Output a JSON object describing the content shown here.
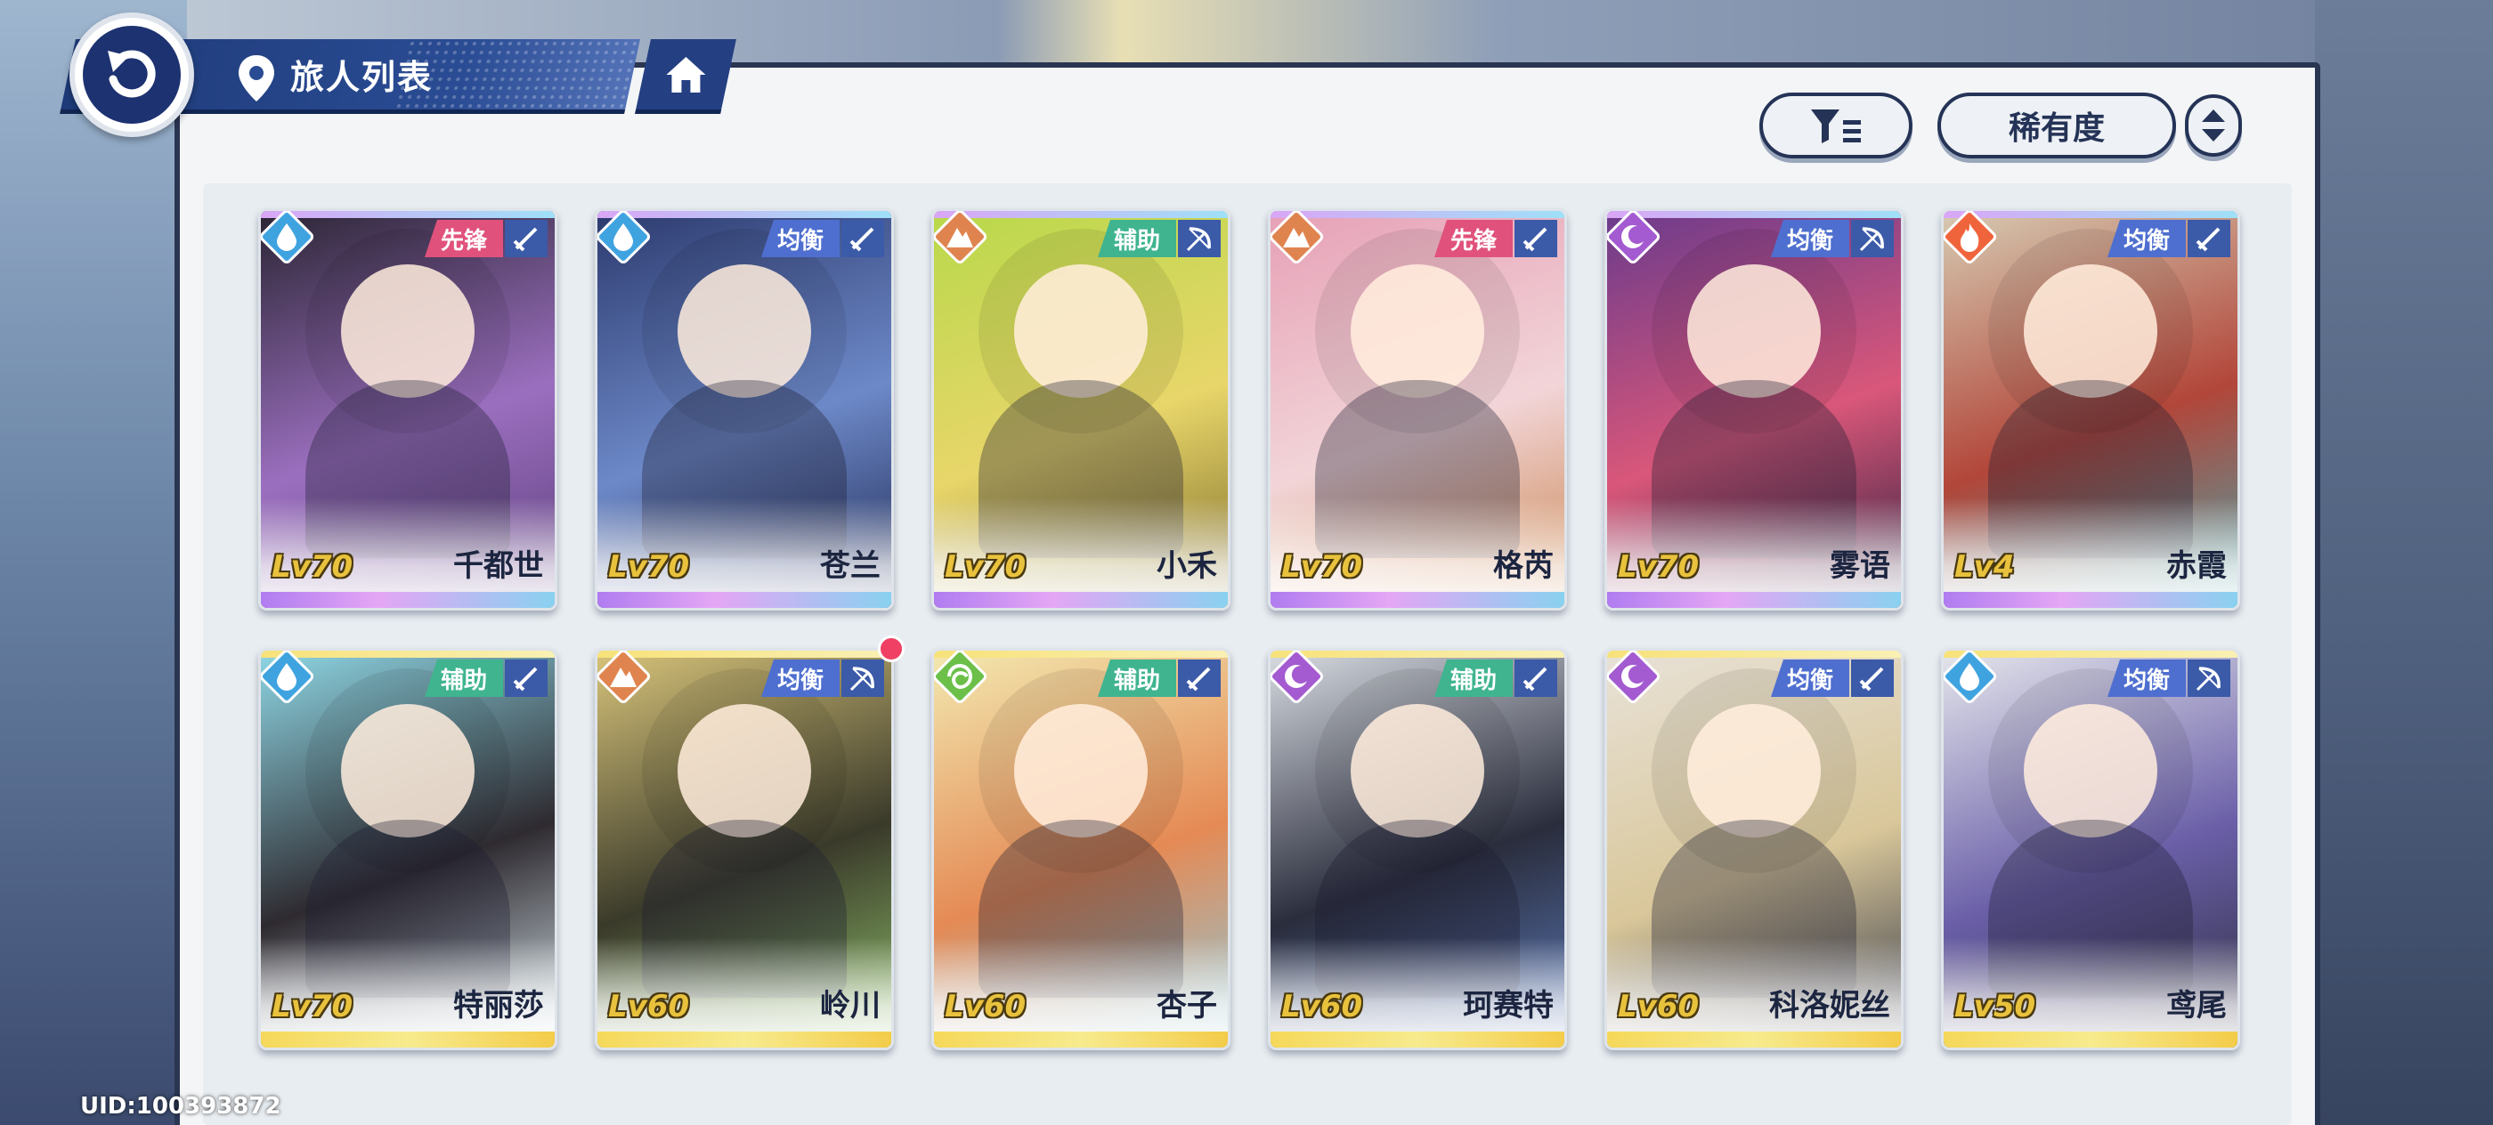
{
  "header": {
    "title": "旅人列表"
  },
  "toolbar": {
    "sort_label": "稀有度"
  },
  "footer": {
    "uid": "UID:100393872"
  },
  "colors": {
    "role": {
      "先锋": "#e0527c",
      "均衡": "#4e6fcf",
      "辅助": "#3fb48f"
    },
    "element": {
      "water": "#3fa3e0",
      "earth": "#e0844f",
      "moon": "#a45ad0",
      "fire": "#f0643c",
      "wind": "#6cc04a"
    }
  },
  "characters": [
    {
      "name": "千都世",
      "level": "Lv70",
      "role": "先锋",
      "element": "water",
      "weapon": "sword-icon",
      "frame": "purple",
      "art": [
        "#2a2533",
        "#9b6fbf",
        "#5b3d7a"
      ]
    },
    {
      "name": "苍兰",
      "level": "Lv70",
      "role": "均衡",
      "element": "water",
      "weapon": "sword-icon",
      "frame": "purple",
      "art": [
        "#2c3a6e",
        "#6d89c8",
        "#1d2650"
      ]
    },
    {
      "name": "小禾",
      "level": "Lv70",
      "role": "辅助",
      "element": "earth",
      "weapon": "bow-icon",
      "frame": "purple",
      "art": [
        "#b8d84a",
        "#e8d66a",
        "#7c6a2a"
      ]
    },
    {
      "name": "格芮",
      "level": "Lv70",
      "role": "先锋",
      "element": "earth",
      "weapon": "sword-icon",
      "frame": "purple",
      "art": [
        "#e6a0b6",
        "#f2d5d8",
        "#c9844d"
      ]
    },
    {
      "name": "雾语",
      "level": "Lv70",
      "role": "均衡",
      "element": "moon",
      "weapon": "bow-icon",
      "frame": "purple",
      "art": [
        "#6a3a8c",
        "#d9577a",
        "#2b1e3c"
      ]
    },
    {
      "name": "赤霞",
      "level": "Lv4",
      "role": "均衡",
      "element": "fire",
      "weapon": "sword-icon",
      "frame": "purple",
      "art": [
        "#d6cbb2",
        "#b2463a",
        "#4aa3a8"
      ]
    },
    {
      "name": "特丽莎",
      "level": "Lv70",
      "role": "辅助",
      "element": "water",
      "weapon": "sword-icon",
      "frame": "gold",
      "art": [
        "#8fd8e6",
        "#2e2a30",
        "#d9e8ee"
      ]
    },
    {
      "name": "岭川",
      "level": "Lv60",
      "role": "均衡",
      "element": "earth",
      "weapon": "bow-icon",
      "frame": "gold",
      "art": [
        "#d8c47a",
        "#3a3a2a",
        "#8fc06a"
      ]
    },
    {
      "name": "杏子",
      "level": "Lv60",
      "role": "辅助",
      "element": "wind",
      "weapon": "sword-icon",
      "frame": "gold",
      "art": [
        "#f2e9b0",
        "#e58a55",
        "#8ec8d8"
      ]
    },
    {
      "name": "珂赛特",
      "level": "Lv60",
      "role": "辅助",
      "element": "moon",
      "weapon": "sword-icon",
      "frame": "gold",
      "art": [
        "#d8dce2",
        "#2a2d3c",
        "#5a78b8"
      ]
    },
    {
      "name": "科洛妮丝",
      "level": "Lv60",
      "role": "均衡",
      "element": "moon",
      "weapon": "sword-icon",
      "frame": "gold",
      "art": [
        "#e8e2d8",
        "#d9c79a",
        "#2e3242"
      ]
    },
    {
      "name": "鸢尾",
      "level": "Lv50",
      "role": "均衡",
      "element": "water",
      "weapon": "bow-icon",
      "frame": "gold",
      "art": [
        "#e5e6ec",
        "#6a5fa8",
        "#2c2d3d"
      ]
    }
  ],
  "notifications": {
    "card_index_with_dot": 7
  }
}
